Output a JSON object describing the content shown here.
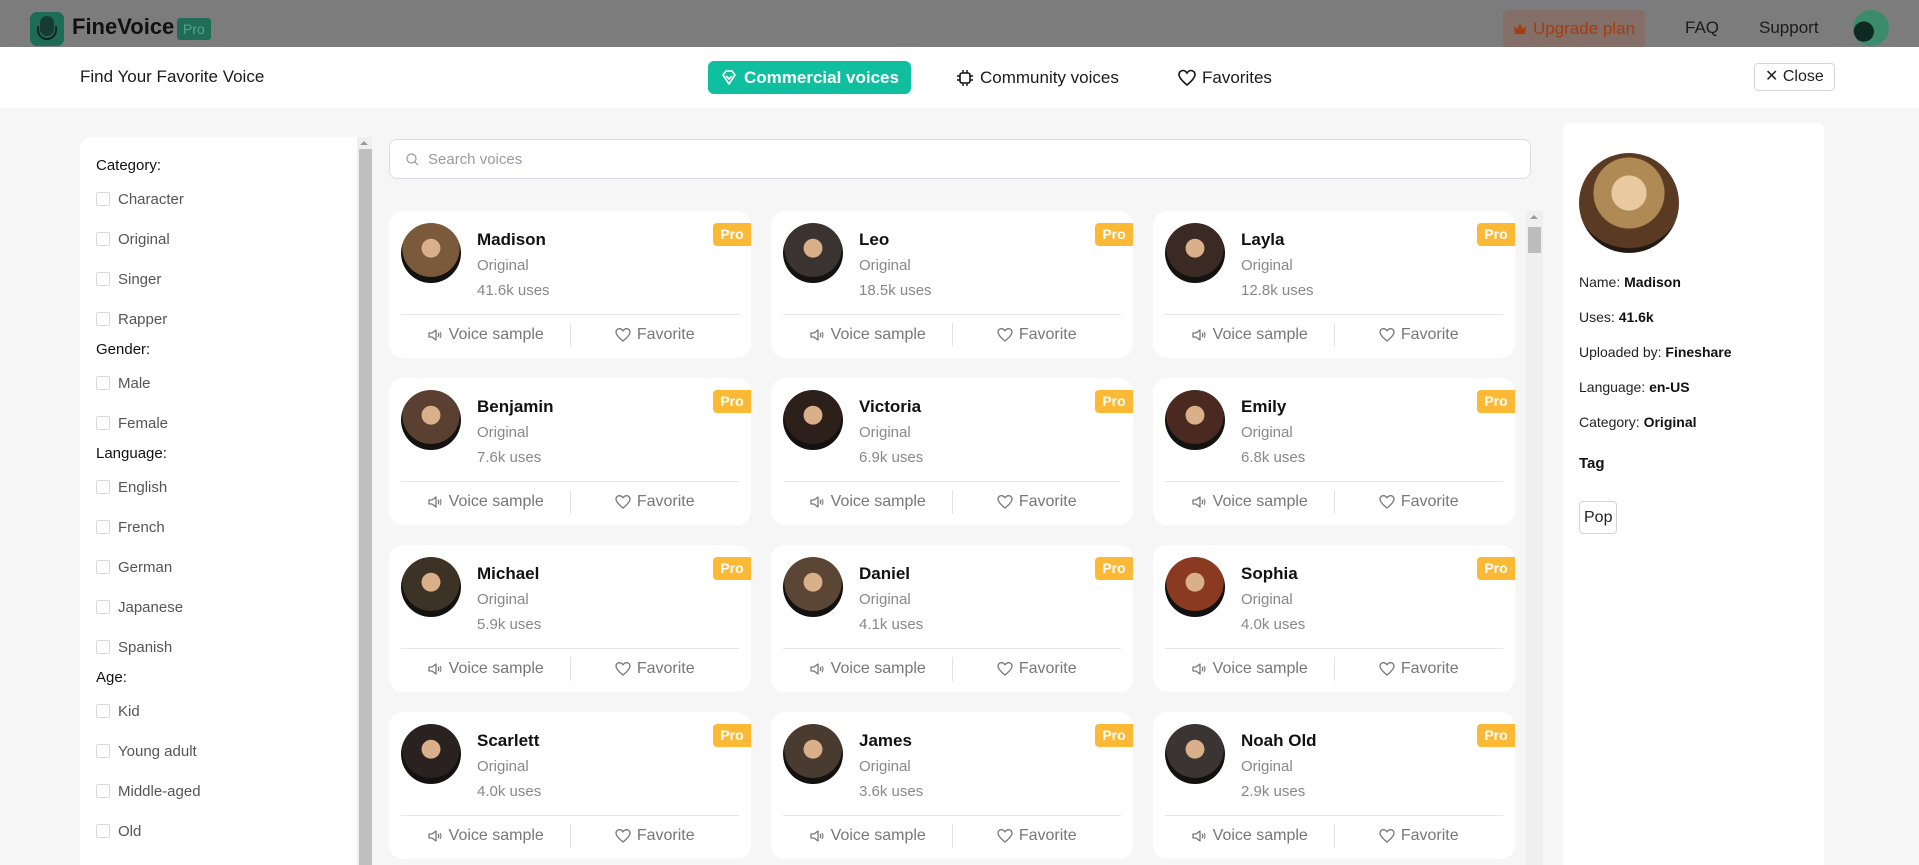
{
  "app": {
    "brand": "FineVoice",
    "brand_badge": "Pro",
    "nav": {
      "upgrade": "Upgrade plan",
      "faq": "FAQ",
      "support": "Support"
    }
  },
  "modal": {
    "title": "Find Your Favorite Voice",
    "tabs": [
      {
        "label": "Commercial voices",
        "icon": "diamond-icon",
        "active": true
      },
      {
        "label": "Community voices",
        "icon": "chip-icon",
        "active": false
      },
      {
        "label": "Favorites",
        "icon": "heart-icon",
        "active": false
      }
    ],
    "close_label": "Close"
  },
  "filters": {
    "groups": [
      {
        "heading": "Category:",
        "options": [
          "Character",
          "Original",
          "Singer",
          "Rapper"
        ]
      },
      {
        "heading": "Gender:",
        "options": [
          "Male",
          "Female"
        ]
      },
      {
        "heading": "Language:",
        "options": [
          "English",
          "French",
          "German",
          "Japanese",
          "Spanish"
        ]
      },
      {
        "heading": "Age:",
        "options": [
          "Kid",
          "Young adult",
          "Middle-aged",
          "Old"
        ]
      }
    ]
  },
  "search": {
    "placeholder": "Search voices",
    "value": ""
  },
  "card_labels": {
    "voice_sample": "Voice sample",
    "favorite": "Favorite",
    "pro": "Pro"
  },
  "voices": [
    {
      "name": "Madison",
      "category": "Original",
      "uses": "41.6k uses",
      "avatar_color": "#7a5a3a"
    },
    {
      "name": "Leo",
      "category": "Original",
      "uses": "18.5k uses",
      "avatar_color": "#3a3330"
    },
    {
      "name": "Layla",
      "category": "Original",
      "uses": "12.8k uses",
      "avatar_color": "#3b2a24"
    },
    {
      "name": "Benjamin",
      "category": "Original",
      "uses": "7.6k uses",
      "avatar_color": "#5a4030"
    },
    {
      "name": "Victoria",
      "category": "Original",
      "uses": "6.9k uses",
      "avatar_color": "#2d1f1a"
    },
    {
      "name": "Emily",
      "category": "Original",
      "uses": "6.8k uses",
      "avatar_color": "#4a2a20"
    },
    {
      "name": "Michael",
      "category": "Original",
      "uses": "5.9k uses",
      "avatar_color": "#3d3226"
    },
    {
      "name": "Daniel",
      "category": "Original",
      "uses": "4.1k uses",
      "avatar_color": "#5b4636"
    },
    {
      "name": "Sophia",
      "category": "Original",
      "uses": "4.0k uses",
      "avatar_color": "#8a3a20"
    },
    {
      "name": "Scarlett",
      "category": "Original",
      "uses": "4.0k uses",
      "avatar_color": "#2a2220"
    },
    {
      "name": "James",
      "category": "Original",
      "uses": "3.6k uses",
      "avatar_color": "#4a3b30"
    },
    {
      "name": "Noah Old",
      "category": "Original",
      "uses": "2.9k uses",
      "avatar_color": "#3a3532"
    }
  ],
  "detail": {
    "name_label": "Name:",
    "name": "Madison",
    "uses_label": "Uses:",
    "uses": "41.6k",
    "uploaded_label": "Uploaded by:",
    "uploaded_by": "Fineshare",
    "language_label": "Language:",
    "language": "en-US",
    "category_label": "Category:",
    "category": "Original",
    "tag_title": "Tag",
    "tags": [
      "Pop"
    ]
  },
  "colors": {
    "accent": "#0fbfa0",
    "pro_badge": "#fcb935",
    "upgrade_text": "#a33e0f"
  }
}
